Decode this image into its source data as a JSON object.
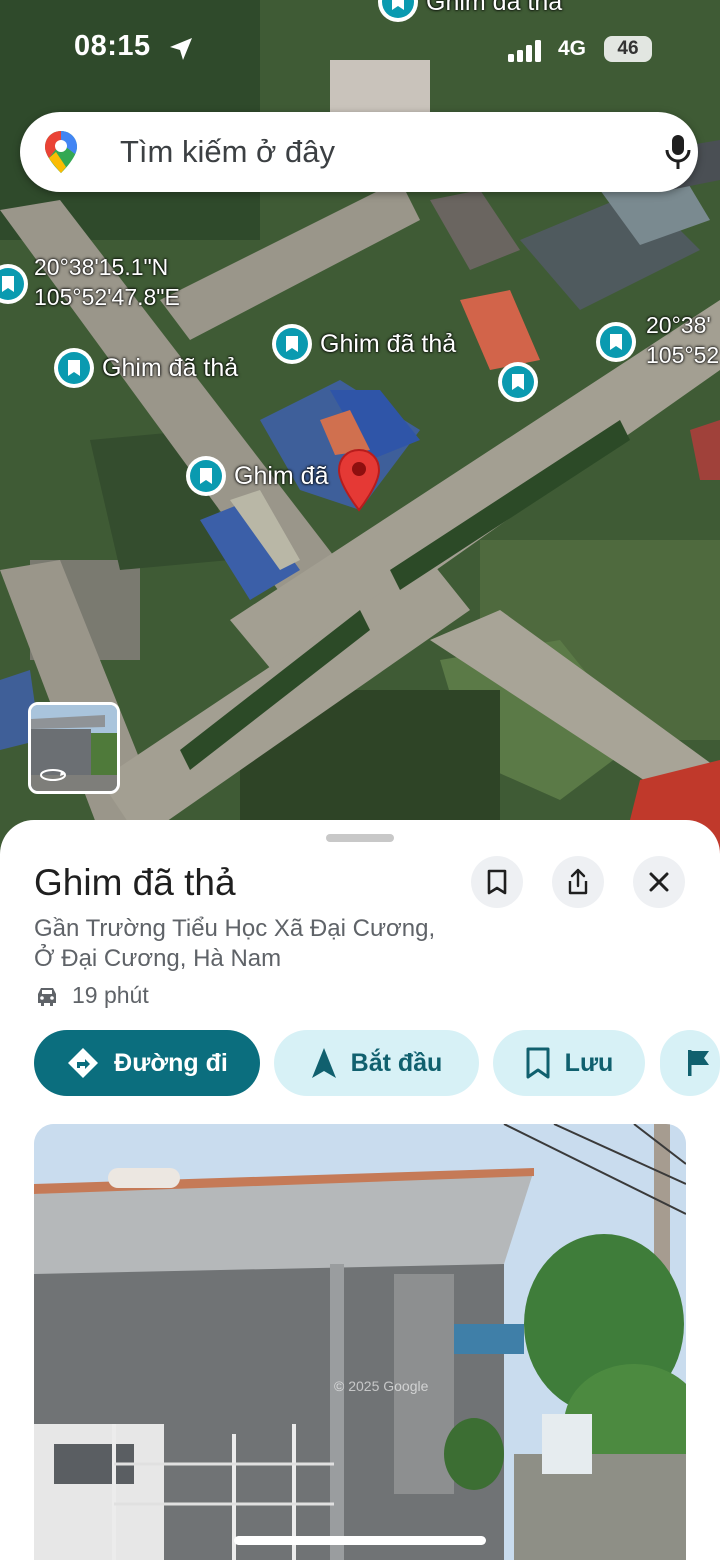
{
  "status_bar": {
    "time": "08:15",
    "network": "4G",
    "battery": "46"
  },
  "search": {
    "placeholder": "Tìm kiếm ở đây",
    "logo_icon": "google-maps-pin-icon",
    "mic_icon": "microphone-icon"
  },
  "map": {
    "top_label": "Ghim đã thả",
    "coord_left": {
      "lat": "20°38'15.1\"N",
      "lng": "105°52'47.8\"E"
    },
    "coord_right": {
      "lat": "20°38'",
      "lng": "105°52"
    },
    "pins": [
      {
        "label": "Ghim đã thả"
      },
      {
        "label": "Ghim đã thả"
      },
      {
        "label": "Ghim đã"
      }
    ],
    "colors": {
      "pin_teal": "#0a9ab0",
      "selected_pin": "#e53935"
    }
  },
  "sheet": {
    "title": "Ghim đã thả",
    "address": "Gần Trường Tiểu Học Xã Đại Cương, Ở Đại Cương, Hà Nam",
    "travel_time": "19 phút",
    "actions": {
      "directions": "Đường đi",
      "start": "Bắt đầu",
      "save": "Lưu"
    },
    "photo_watermark": "© 2025 Google",
    "colors": {
      "primary": "#0b6e7e",
      "chip_bg": "#d7f1f6"
    }
  }
}
